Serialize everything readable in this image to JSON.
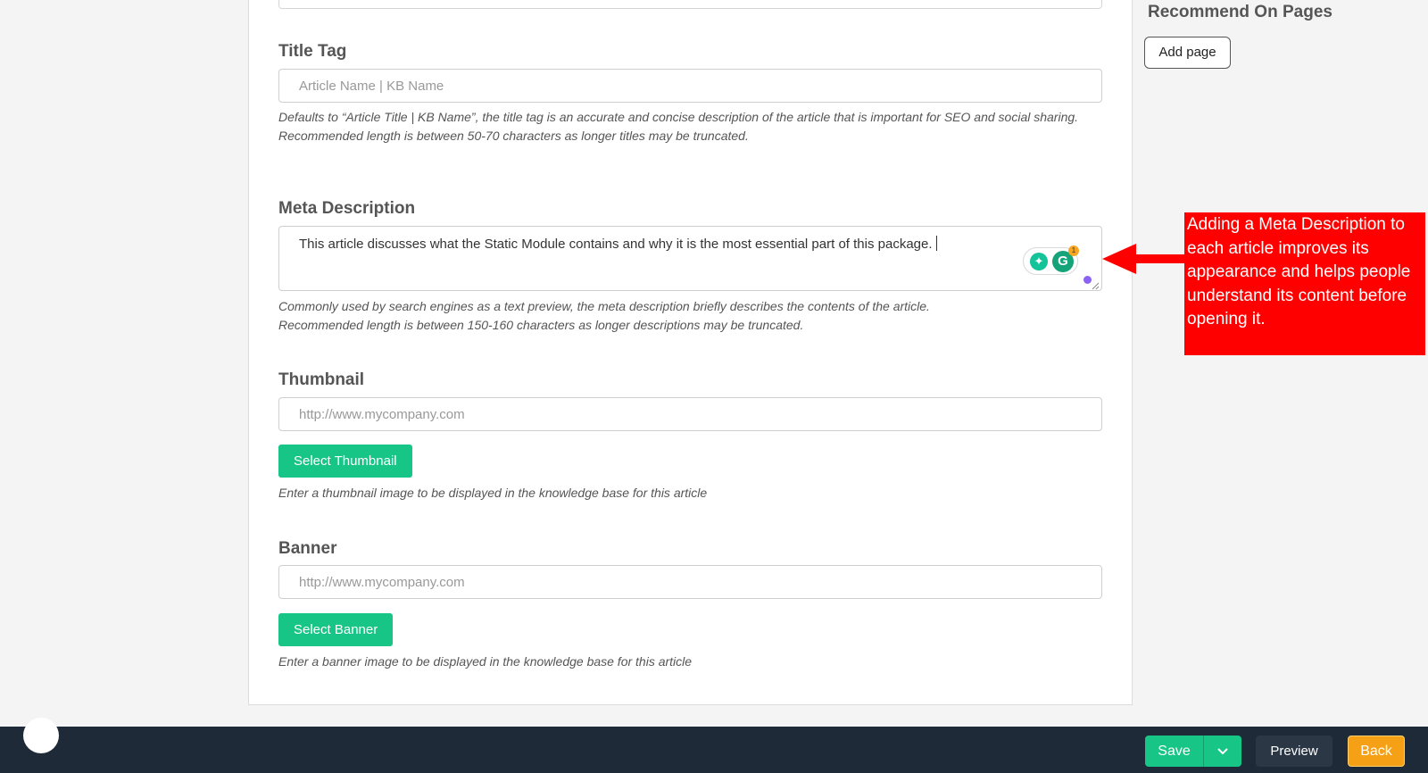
{
  "form": {
    "title_tag": {
      "label": "Title Tag",
      "placeholder": "Article Name | KB Name",
      "help_line1": "Defaults to “Article Title | KB Name”, the title tag is an accurate and concise description of the article that is important for SEO and social sharing.",
      "help_line2": "Recommended length is between 50-70 characters as longer titles may be truncated."
    },
    "meta_description": {
      "label": "Meta Description",
      "value": "This article discusses what the Static Module contains and why it is the most essential part of this package.",
      "help_line1": "Commonly used by search engines as a text preview, the meta description briefly describes the contents of the article.",
      "help_line2": "Recommended length is between 150-160 characters as longer descriptions may be truncated.",
      "grammarly_count": "1"
    },
    "thumbnail": {
      "label": "Thumbnail",
      "placeholder": "http://www.mycompany.com",
      "button": "Select Thumbnail",
      "help": "Enter a thumbnail image to be displayed in the knowledge base for this article"
    },
    "banner": {
      "label": "Banner",
      "placeholder": "http://www.mycompany.com",
      "button": "Select Banner",
      "help": "Enter a banner image to be displayed in the knowledge base for this article"
    }
  },
  "sidebar": {
    "title": "Recommend On Pages",
    "add_page": "Add page"
  },
  "annotation": {
    "text": "Adding a Meta Description to each article improves its appearance and helps people understand its content before opening it."
  },
  "footer": {
    "save": "Save",
    "preview": "Preview",
    "back": "Back"
  },
  "colors": {
    "primary_green": "#17c586",
    "back_orange": "#f5a015",
    "annotation_red": "#ff0000",
    "footer_bg": "#1e2a38"
  },
  "icons": [
    "lightbulb-icon",
    "grammarly-icon",
    "chevron-down-icon",
    "red-arrow-icon",
    "resize-handle-icon"
  ]
}
